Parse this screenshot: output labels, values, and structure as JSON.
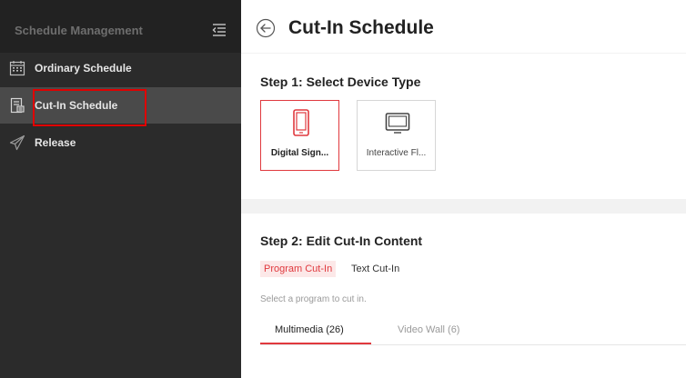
{
  "sidebar": {
    "title": "Schedule Management",
    "items": [
      {
        "label": "Ordinary Schedule",
        "icon": "calendar-icon"
      },
      {
        "label": "Cut-In Schedule",
        "icon": "document-icon",
        "active": true
      },
      {
        "label": "Release",
        "icon": "paper-plane-icon"
      }
    ]
  },
  "header": {
    "title": "Cut-In Schedule"
  },
  "step1": {
    "title": "Step 1: Select Device Type",
    "devices": [
      {
        "label": "Digital Sign...",
        "selected": true,
        "icon": "tablet-icon"
      },
      {
        "label": "Interactive Fl...",
        "selected": false,
        "icon": "monitor-icon"
      }
    ]
  },
  "step2": {
    "title": "Step 2: Edit Cut-In Content",
    "content_types": [
      "Program Cut-In",
      "Text Cut-In"
    ],
    "hint": "Select a program to cut in.",
    "tabs": [
      "Multimedia (26)",
      "Video Wall (6)"
    ]
  },
  "colors": {
    "accent": "#e0393e",
    "sidebar_bg": "#2b2b2b",
    "sidebar_active": "#4a4a4a",
    "annotation": "#e00000"
  }
}
